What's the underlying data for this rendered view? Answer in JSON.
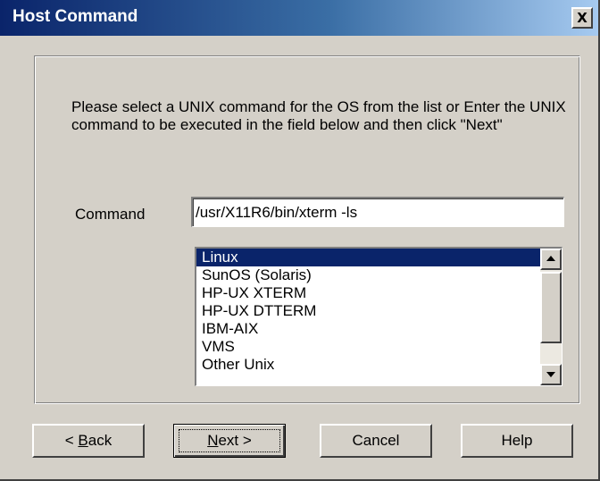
{
  "window": {
    "title": "Host Command",
    "close_glyph": "X"
  },
  "instructions": "Please select a UNIX command for the OS from the list  or Enter the UNIX command to be executed in the field below and then click \"Next\"",
  "command": {
    "label": "Command",
    "value": "/usr/X11R6/bin/xterm -ls"
  },
  "os_list": {
    "selected_index": 0,
    "items": [
      "Linux",
      "SunOS (Solaris)",
      "HP-UX XTERM",
      "HP-UX DTTERM",
      "IBM-AIX",
      "VMS",
      "Other Unix"
    ]
  },
  "buttons": {
    "back_prefix": "< ",
    "back_mnemonic": "B",
    "back_rest": "ack",
    "next_mnemonic": "N",
    "next_rest": "ext >",
    "cancel": "Cancel",
    "help": "Help"
  },
  "colors": {
    "selection": "#0a246a",
    "face": "#d4d0c8"
  }
}
